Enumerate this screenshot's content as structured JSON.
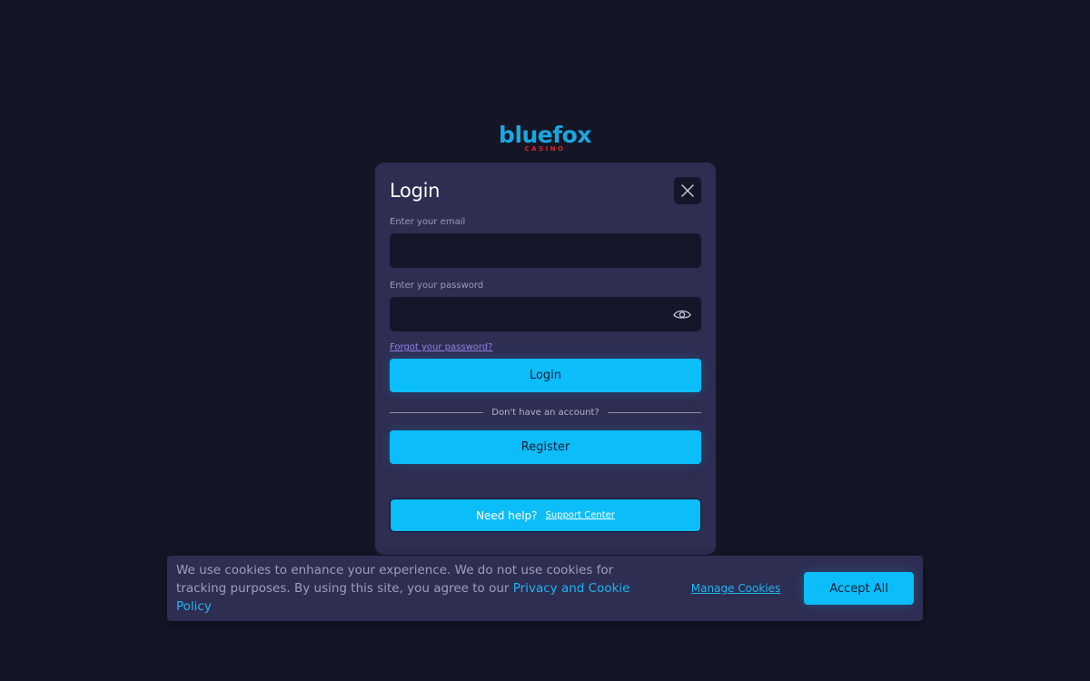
{
  "logo": {
    "main": "bluefox",
    "sub": "CASINO"
  },
  "modal": {
    "title": "Login",
    "email_label": "Enter your email",
    "email_value": "",
    "password_label": "Enter your password",
    "password_value": "",
    "forgot_link": "Forgot your password?",
    "login_button": "Login",
    "divider_text": "Don't have an account?",
    "register_button": "Register",
    "help_text": "Need help?",
    "support_link": "Support Center"
  },
  "cookie_banner": {
    "text": "We use cookies to enhance your experience. We do not use cookies for tracking purposes. By using this site, you agree to our ",
    "policy_link": "Privacy and Cookie Policy",
    "manage_link": "Manage Cookies",
    "accept_button": "Accept All"
  },
  "icons": {
    "close": "close-icon",
    "password_visibility": "eye-icon"
  },
  "colors": {
    "background": "#141626",
    "card": "#2e2d52",
    "input": "#15162a",
    "accent": "#0bbdf8",
    "logo_blue": "#1aa6e0",
    "logo_red": "#e0242c",
    "link_purple": "#8f86e6"
  }
}
